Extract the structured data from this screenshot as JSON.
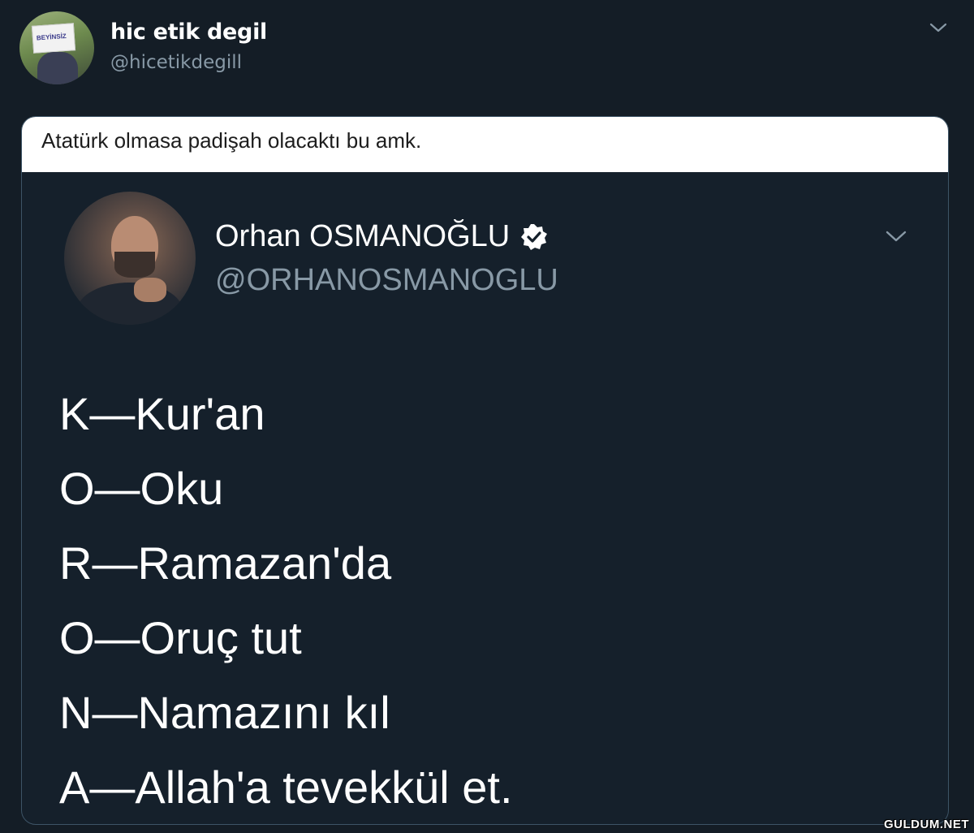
{
  "outer_tweet": {
    "display_name": "hic etik degil",
    "handle": "@hicetikdegill",
    "avatar_sign_text": "BEYİNSİZ"
  },
  "embedded_image": {
    "caption": "Atatürk olmasa padişah olacaktı bu amk.",
    "inner_tweet": {
      "display_name": "Orhan OSMANOĞLU",
      "handle": "@ORHANOSMANOGLU",
      "verified": true,
      "lines": [
        "K—Kur'an",
        "O—Oku",
        "R—Ramazan'da",
        "O—Oruç tut",
        "N—Namazını kıl",
        "A—Allah'a tevekkül et."
      ]
    }
  },
  "watermark": "GULDUM.NET",
  "colors": {
    "background": "#141d26",
    "card_background": "#15202b",
    "secondary_text": "#8899a6",
    "verified_badge": "#ffffff"
  },
  "icons": {
    "outer_menu": "chevron-down-icon",
    "inner_menu": "chevron-down-icon",
    "verified": "verified-badge-icon"
  }
}
